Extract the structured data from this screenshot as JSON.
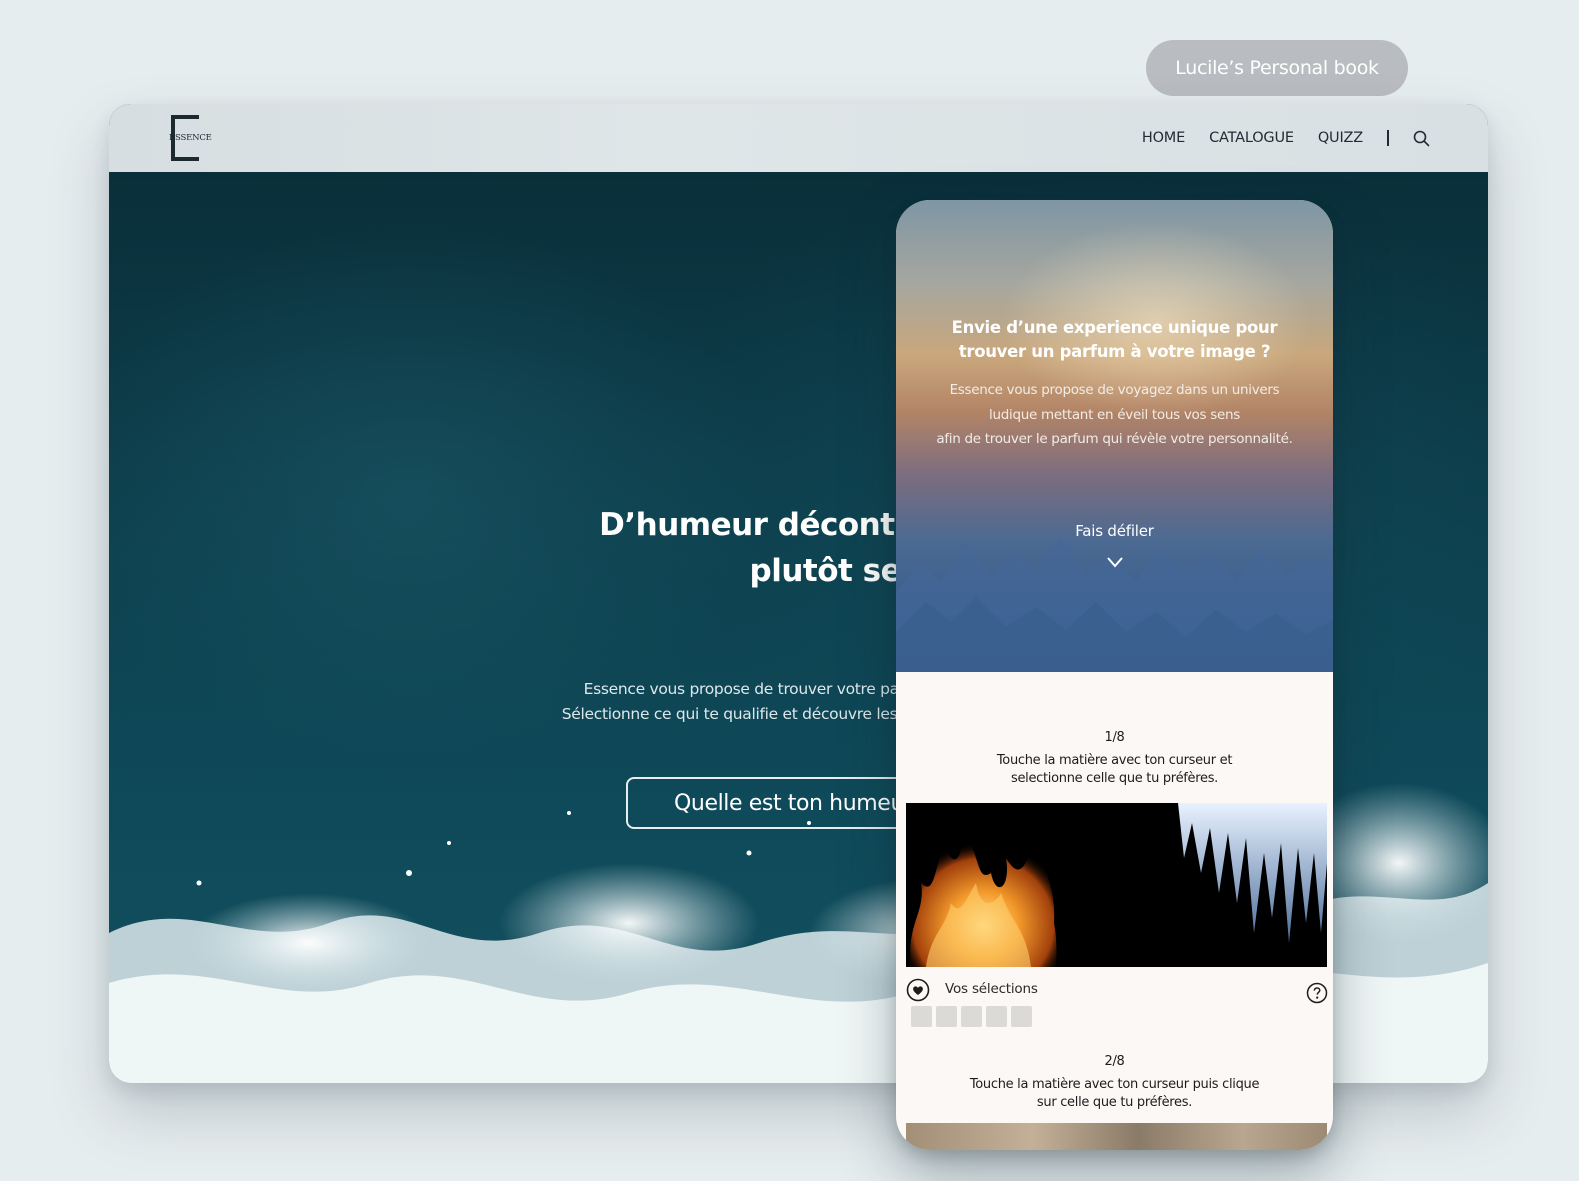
{
  "badge": {
    "label": "Lucile’s Personal book"
  },
  "site": {
    "logo_text": "ESSENCE",
    "nav": {
      "home": "HOME",
      "catalogue": "CATALOGUE",
      "quizz": "QUIZZ",
      "separator": "|"
    },
    "hero": {
      "title_line1": "D’humeur décontractée",
      "title_line2": "plutôt sensuell",
      "sub_line1": "Essence vous propose de trouver votre parfum",
      "sub_line2": "Sélectionne ce qui te qualifie et découvre les parfum",
      "button": "Quelle est ton humeu"
    }
  },
  "mobile": {
    "title_line1": "Envie d’une experience unique pour",
    "title_line2": "trouver un parfum à votre image ?",
    "sub_line1": "Essence vous propose de voyagez dans un univers",
    "sub_line2": "ludique mettant en éveil tous vos sens",
    "sub_line3": "afin de trouver le parfum qui révèle votre personnalité.",
    "scroll_label": "Fais défiler",
    "step1": {
      "counter": "1/8",
      "line1": "Touche la matière avec ton curseur et",
      "line2": "selectionne celle que tu préfères."
    },
    "selections_label": "Vos sélections",
    "selection_slots": 5,
    "step2": {
      "counter": "2/8",
      "line1": "Touche la matière avec ton curseur puis clique",
      "line2": "sur celle que tu préfères."
    }
  },
  "colors": {
    "background": "#e6edef",
    "nav_text": "#1f2c33",
    "hero_ocean": "#0d4250",
    "badge_bg": "#b9bcc0"
  }
}
